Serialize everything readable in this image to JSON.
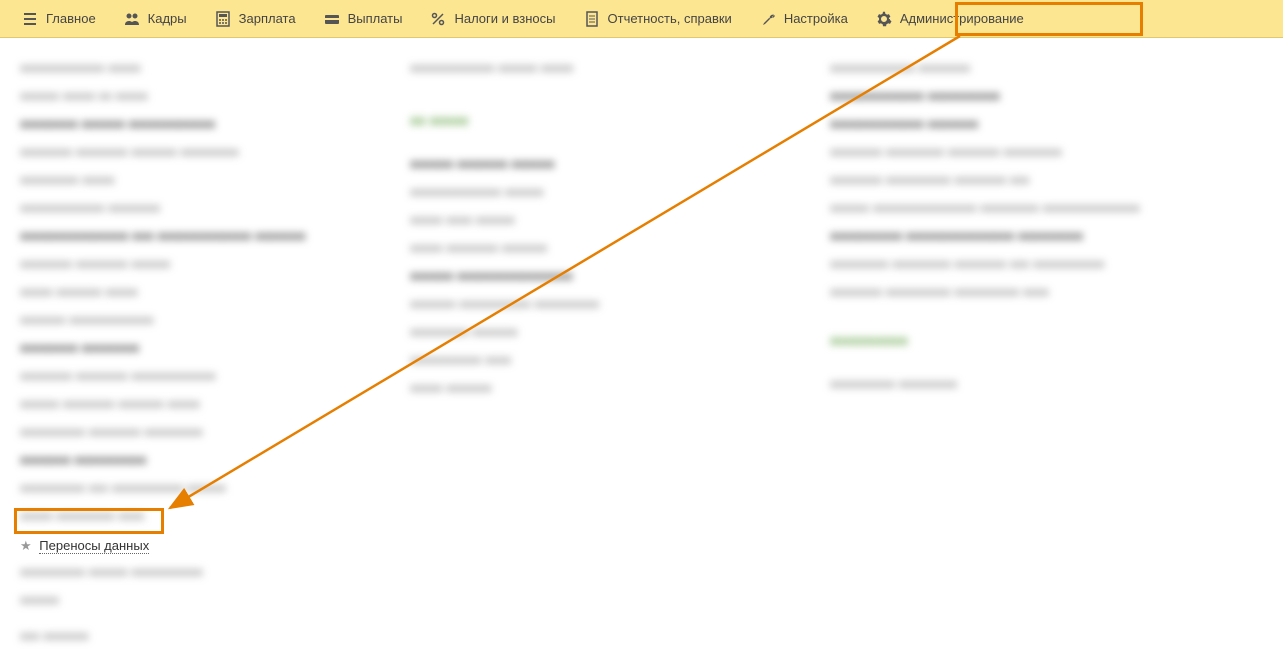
{
  "toolbar": {
    "main": "Главное",
    "hr": "Кадры",
    "payroll": "Зарплата",
    "payments": "Выплаты",
    "taxes": "Налоги и взносы",
    "reports": "Отчетность, справки",
    "settings": "Настройка",
    "admin": "Администрирование"
  },
  "columns": {
    "col1": {
      "lines": [
        "xxxxxxxxxxxxx xxxxx",
        "xxxxxx xxxxx xx xxxxx",
        "xxxxxxxx xxxxxx xxxxxxxxxxxx",
        "xxxxxxxx xxxxxxxx xxxxxxx xxxxxxxxx",
        "xxxxxxxxx xxxxx",
        "xxxxxxxxxxxxx xxxxxxxx",
        "xxxxxxxxxxxxxxx xxx xxxxxxxxxxxxx xxxxxxx",
        "xxxxxxxx xxxxxxxx xxxxxx",
        "xxxxx xxxxxxx xxxxx",
        "xxxxxxx xxxxxxxxxxxxx",
        "xxxxxxxx xxxxxxxx",
        "xxxxxxxx xxxxxxxx xxxxxxxxxxxxx",
        "xxxxxx xxxxxxxx xxxxxxx xxxxx",
        "xxxxxxxxxx xxxxxxxx xxxxxxxxx",
        "xxxxxxx xxxxxxxxxx",
        "xxxxxxxxxx xxx xxxxxxxxxxx xxxxxx",
        "xxxxx xxxxxxxxx xxxx"
      ],
      "target": "Переносы данных",
      "after": [
        "xxxxxxxxxx xxxxxx xxxxxxxxxxx",
        "xxxxxx",
        "",
        "xxx xxxxxxx"
      ]
    },
    "col2": {
      "header_line": "xxxxxxxxxxxxx xxxxxx xxxxx",
      "section": "xx xxxxx",
      "lines": [
        "xxxxxx xxxxxxx xxxxxx",
        "xxxxxxxxxxxxxx xxxxxx",
        "xxxxx xxxx xxxxxx",
        "xxxxx xxxxxxxx xxxxxxx",
        "xxxxxx xxxxxxxxxxxxxxxx",
        "xxxxxxx xxxxxxxxxxx xxxxxxxxxx",
        "xxxxxxxxx xxxxxxx",
        "xxxxxxxxxxx xxxx",
        "xxxxx xxxxxxx"
      ]
    },
    "col3": {
      "lines_top": [
        "xxxxxxxxxxxxx xxxxxxxx",
        "xxxxxxxxxxxxx xxxxxxxxxx",
        "xxxxxxxxxxxxx xxxxxxx",
        "xxxxxxxx xxxxxxxxx xxxxxxxx xxxxxxxxx",
        "xxxxxxxx xxxxxxxxxx xxxxxxxx xxx",
        "xxxxxx xxxxxxxxxxxxxxxx xxxxxxxxx xxxxxxxxxxxxxxx",
        "xxxxxxxxxx xxxxxxxxxxxxxxx xxxxxxxxx",
        "xxxxxxxxx xxxxxxxxx xxxxxxxx xxx xxxxxxxxxxx",
        "xxxxxxxx xxxxxxxxxx xxxxxxxxxx xxxx"
      ],
      "section": "xxxxxxxxxx",
      "lines_bottom": [
        "xxxxxxxxxx xxxxxxxxx"
      ]
    }
  }
}
